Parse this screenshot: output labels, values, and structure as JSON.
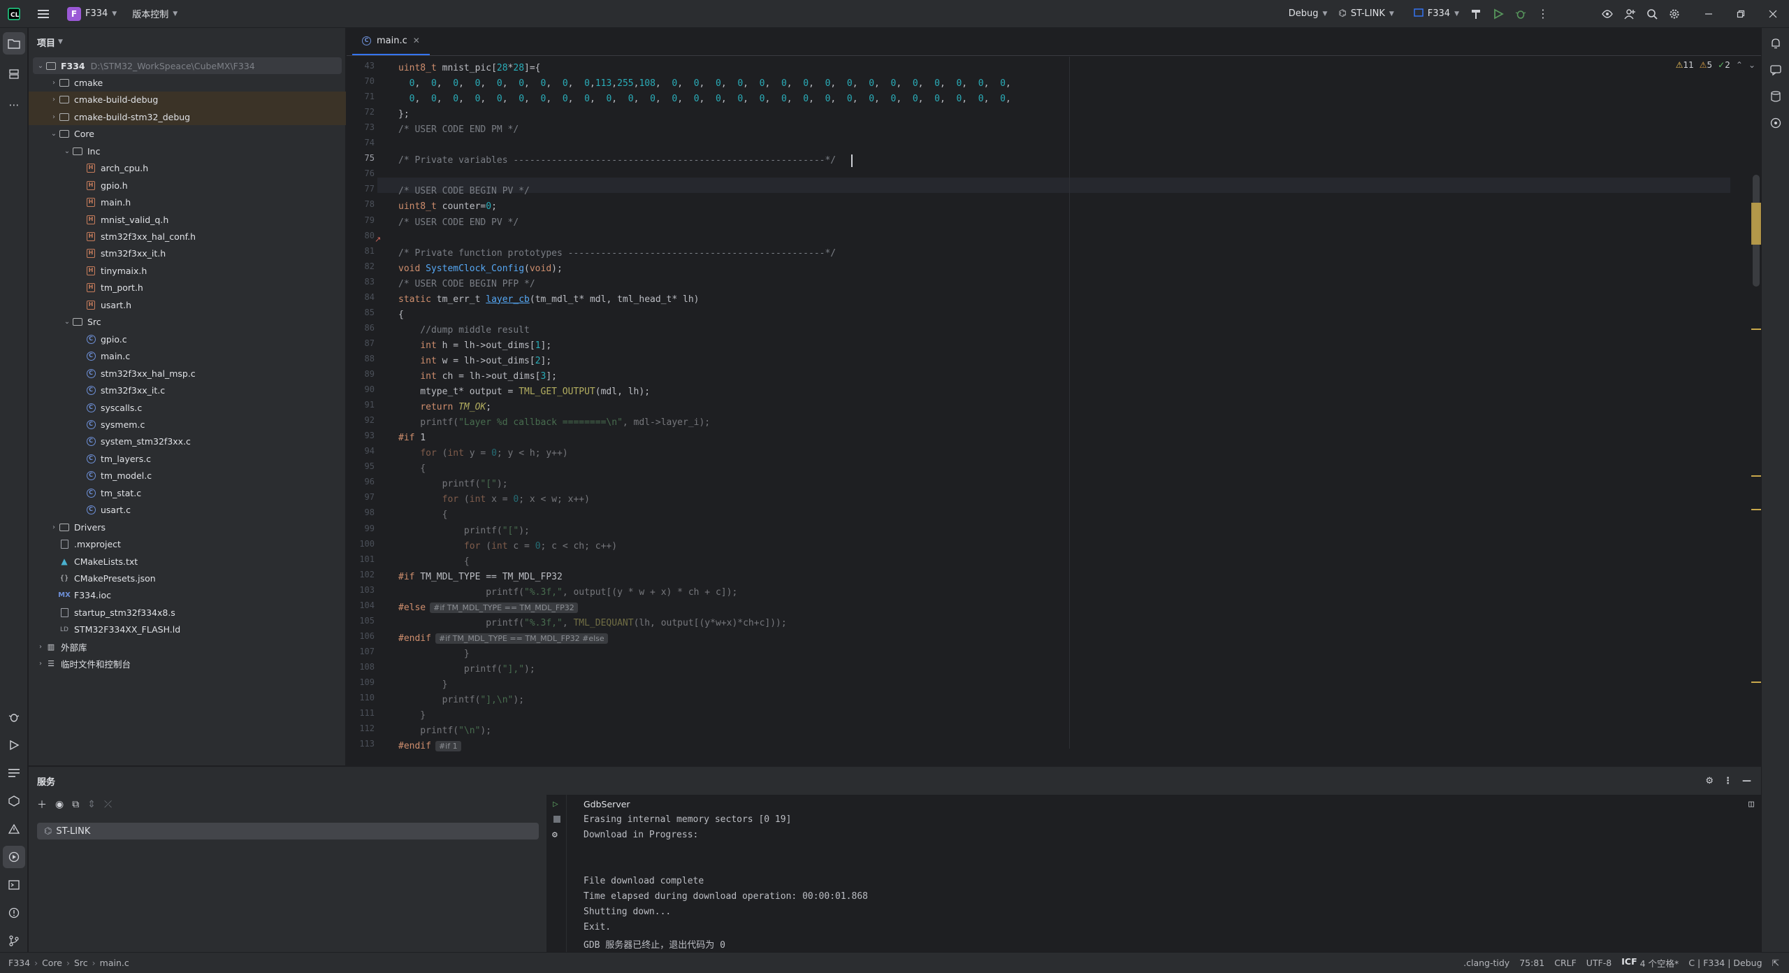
{
  "titlebar": {
    "project_badge": "F",
    "project_name": "F334",
    "vcs": "版本控制",
    "run_config": "Debug",
    "debugger": "ST-LINK",
    "target": "F334"
  },
  "project_panel": {
    "title": "项目",
    "items": [
      {
        "label": "F334",
        "path": "D:\\STM32_WorkSpeace\\CubeMX\\F334",
        "icon": "folder-icon",
        "depth": 0,
        "arrow": "open"
      },
      {
        "label": "cmake",
        "icon": "folder-icon",
        "depth": 1,
        "arrow": "closed"
      },
      {
        "label": "cmake-build-debug",
        "icon": "folder-icon",
        "depth": 1,
        "arrow": "closed",
        "excluded": true
      },
      {
        "label": "cmake-build-stm32_debug",
        "icon": "folder-icon",
        "depth": 1,
        "arrow": "closed",
        "excluded": true
      },
      {
        "label": "Core",
        "icon": "folder-icon",
        "depth": 1,
        "arrow": "open"
      },
      {
        "label": "Inc",
        "icon": "folder-icon",
        "depth": 2,
        "arrow": "open"
      },
      {
        "label": "arch_cpu.h",
        "icon": "h-file-icon",
        "depth": 3
      },
      {
        "label": "gpio.h",
        "icon": "h-file-icon",
        "depth": 3
      },
      {
        "label": "main.h",
        "icon": "h-file-icon",
        "depth": 3
      },
      {
        "label": "mnist_valid_q.h",
        "icon": "h-file-icon",
        "depth": 3
      },
      {
        "label": "stm32f3xx_hal_conf.h",
        "icon": "h-file-icon",
        "depth": 3
      },
      {
        "label": "stm32f3xx_it.h",
        "icon": "h-file-icon",
        "depth": 3
      },
      {
        "label": "tinymaix.h",
        "icon": "h-file-icon",
        "depth": 3
      },
      {
        "label": "tm_port.h",
        "icon": "h-file-icon",
        "depth": 3
      },
      {
        "label": "usart.h",
        "icon": "h-file-icon",
        "depth": 3
      },
      {
        "label": "Src",
        "icon": "folder-icon",
        "depth": 2,
        "arrow": "open"
      },
      {
        "label": "gpio.c",
        "icon": "c-file-icon",
        "depth": 3
      },
      {
        "label": "main.c",
        "icon": "c-file-icon",
        "depth": 3
      },
      {
        "label": "stm32f3xx_hal_msp.c",
        "icon": "c-file-icon",
        "depth": 3
      },
      {
        "label": "stm32f3xx_it.c",
        "icon": "c-file-icon",
        "depth": 3
      },
      {
        "label": "syscalls.c",
        "icon": "c-file-icon",
        "depth": 3
      },
      {
        "label": "sysmem.c",
        "icon": "c-file-icon",
        "depth": 3
      },
      {
        "label": "system_stm32f3xx.c",
        "icon": "c-file-icon",
        "depth": 3
      },
      {
        "label": "tm_layers.c",
        "icon": "c-file-icon",
        "depth": 3
      },
      {
        "label": "tm_model.c",
        "icon": "c-file-icon",
        "depth": 3
      },
      {
        "label": "tm_stat.c",
        "icon": "c-file-icon",
        "depth": 3
      },
      {
        "label": "usart.c",
        "icon": "c-file-icon",
        "depth": 3
      },
      {
        "label": "Drivers",
        "icon": "folder-icon",
        "depth": 1,
        "arrow": "closed"
      },
      {
        "label": ".mxproject",
        "icon": "text-file-icon",
        "depth": 1
      },
      {
        "label": "CMakeLists.txt",
        "icon": "cmake-icon",
        "depth": 1
      },
      {
        "label": "CMakePresets.json",
        "icon": "json-icon",
        "depth": 1
      },
      {
        "label": "F334.ioc",
        "icon": "ioc-icon",
        "depth": 1
      },
      {
        "label": "startup_stm32f334x8.s",
        "icon": "text-file-icon",
        "depth": 1
      },
      {
        "label": "STM32F334XX_FLASH.ld",
        "icon": "ld-file-icon",
        "depth": 1
      },
      {
        "label": "外部库",
        "icon": "library-icon",
        "depth": 0,
        "arrow": "closed"
      },
      {
        "label": "临时文件和控制台",
        "icon": "scratch-icon",
        "depth": 0,
        "arrow": "closed"
      }
    ]
  },
  "editor": {
    "tab_label": "main.c",
    "inspections": {
      "errors": "11",
      "warnings": "5",
      "weak": "2"
    },
    "lines": [
      {
        "n": "43",
        "text": "uint8_t mnist_pic[28*28]={"
      },
      {
        "n": "70",
        "text": "  0,  0,  0,  0,  0,  0,  0,  0,  0,113,255,108,  0,  0,  0,  0,  0,  0,  0,  0,  0,  0,  0,  0,  0,  0,  0,  0,"
      },
      {
        "n": "71",
        "text": "  0,  0,  0,  0,  0,  0,  0,  0,  0,  0,  0,  0,  0,  0,  0,  0,  0,  0,  0,  0,  0,  0,  0,  0,  0,  0,  0,  0,"
      },
      {
        "n": "72",
        "text": "};"
      },
      {
        "n": "73",
        "text": "/* USER CODE END PM */"
      },
      {
        "n": "74",
        "text": ""
      },
      {
        "n": "75",
        "text": "/* Private variables ---------------------------------------------------------*/"
      },
      {
        "n": "76",
        "text": ""
      },
      {
        "n": "77",
        "text": "/* USER CODE BEGIN PV */"
      },
      {
        "n": "78",
        "text": "uint8_t counter=0;"
      },
      {
        "n": "79",
        "text": "/* USER CODE END PV */"
      },
      {
        "n": "80",
        "text": ""
      },
      {
        "n": "81",
        "text": "/* Private function prototypes -----------------------------------------------*/"
      },
      {
        "n": "82",
        "text": "void SystemClock_Config(void);"
      },
      {
        "n": "83",
        "text": "/* USER CODE BEGIN PFP */"
      },
      {
        "n": "84",
        "text": "static tm_err_t layer_cb(tm_mdl_t* mdl, tml_head_t* lh)"
      },
      {
        "n": "85",
        "text": "{"
      },
      {
        "n": "86",
        "text": "    //dump middle result"
      },
      {
        "n": "87",
        "text": "    int h = lh->out_dims[1];"
      },
      {
        "n": "88",
        "text": "    int w = lh->out_dims[2];"
      },
      {
        "n": "89",
        "text": "    int ch = lh->out_dims[3];"
      },
      {
        "n": "90",
        "text": "    mtype_t* output = TML_GET_OUTPUT(mdl, lh);"
      },
      {
        "n": "91",
        "text": "    return TM_OK;"
      },
      {
        "n": "92",
        "text": "    printf(\"Layer %d callback ========\\n\", mdl->layer_i);"
      },
      {
        "n": "93",
        "text": "#if 1"
      },
      {
        "n": "94",
        "text": "    for (int y = 0; y < h; y++)"
      },
      {
        "n": "95",
        "text": "    {"
      },
      {
        "n": "96",
        "text": "        printf(\"[\");"
      },
      {
        "n": "97",
        "text": "        for (int x = 0; x < w; x++)"
      },
      {
        "n": "98",
        "text": "        {"
      },
      {
        "n": "99",
        "text": "            printf(\"[\");"
      },
      {
        "n": "100",
        "text": "            for (int c = 0; c < ch; c++)"
      },
      {
        "n": "101",
        "text": "            {"
      },
      {
        "n": "102",
        "text": "#if TM_MDL_TYPE == TM_MDL_FP32"
      },
      {
        "n": "103",
        "text": "                printf(\"%.3f,\", output[(y * w + x) * ch + c]);"
      },
      {
        "n": "104",
        "text": "#else"
      },
      {
        "n": "105",
        "text": "                printf(\"%.3f,\", TML_DEQUANT(lh, output[(y*w+x)*ch+c]));"
      },
      {
        "n": "106",
        "text": "#endif"
      },
      {
        "n": "107",
        "text": "            }"
      },
      {
        "n": "108",
        "text": "            printf(\"],\");"
      },
      {
        "n": "109",
        "text": "        }"
      },
      {
        "n": "110",
        "text": "        printf(\"],\\n\");"
      },
      {
        "n": "111",
        "text": "    }"
      },
      {
        "n": "112",
        "text": "    printf(\"\\n\");"
      },
      {
        "n": "113",
        "text": "#endif"
      }
    ],
    "inlays": {
      "l104": "#if TM_MDL_TYPE == TM_MDL_FP32",
      "l106": "#if TM_MDL_TYPE == TM_MDL_FP32 #else",
      "l113": "#if 1"
    }
  },
  "services": {
    "title": "服务",
    "tree_item": "ST-LINK",
    "console_title": "GdbServer",
    "console_lines": [
      "Erasing internal memory sectors [0 19]",
      "Download in Progress:",
      "",
      "",
      "File download complete",
      "Time elapsed during download operation: 00:00:01.868",
      "Shutting down...",
      "Exit.",
      "GDB 服务器已终止，退出代码为 0"
    ]
  },
  "statusbar": {
    "breadcrumbs": [
      "F334",
      "Core",
      "Src",
      "main.c"
    ],
    "linter": ".clang-tidy",
    "position": "75:81",
    "line_sep": "CRLF",
    "encoding": "UTF-8",
    "indent": "4 个空格*",
    "indent_badge": "ICF",
    "context": "C | F334 | Debug"
  }
}
